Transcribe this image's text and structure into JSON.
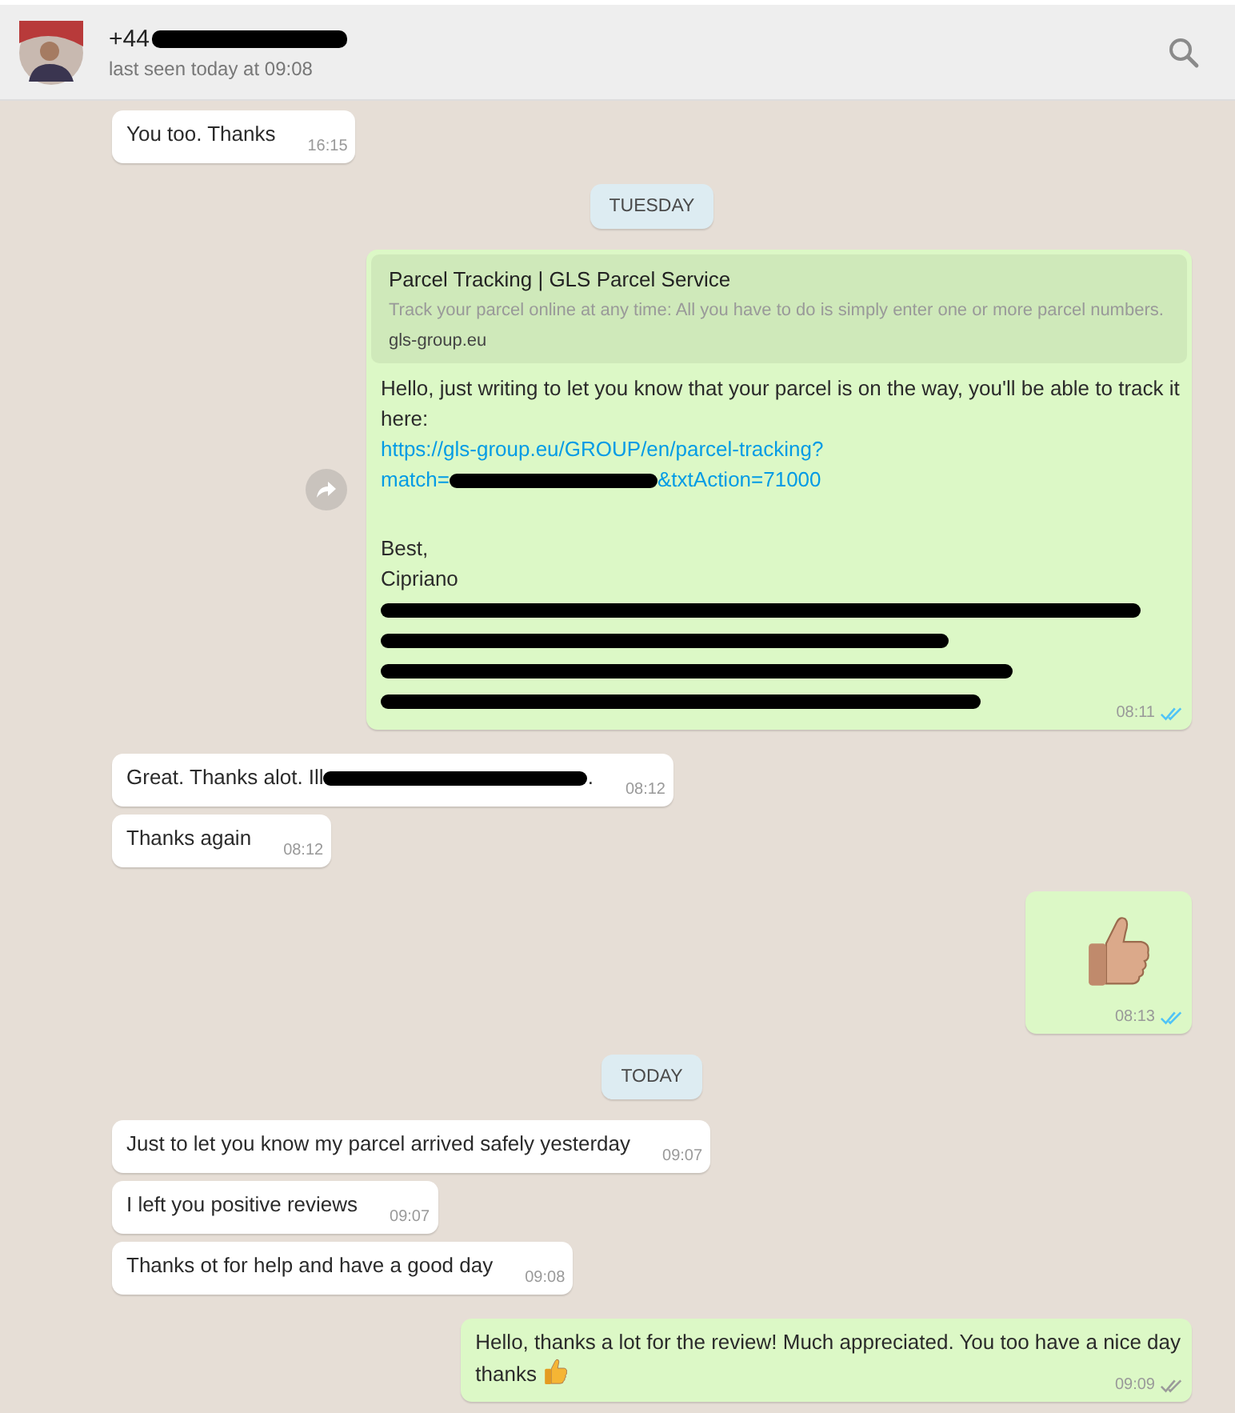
{
  "header": {
    "name": "+44",
    "subtitle": "last seen today at 09:08"
  },
  "messages": [
    {
      "kind": "in",
      "blocks": [
        [
          {
            "kind": "text",
            "text": "You too. Thanks"
          }
        ]
      ],
      "time": "16:15"
    },
    {
      "kind": "date",
      "label": "TUESDAY"
    },
    {
      "kind": "out",
      "forward": true,
      "read": true,
      "time": "08:11",
      "preview": {
        "title": "Parcel Tracking | GLS Parcel Service",
        "description": "Track your parcel online at any time: All you have to do is simply enter one or more parcel numbers.",
        "domain": "gls-group.eu"
      },
      "blocks": [
        [
          {
            "kind": "text",
            "text": "Hello, just writing to let you know that your parcel is on the way, you'll be able to track it here:"
          }
        ],
        [
          {
            "kind": "link",
            "text": "https://gls-group.eu/GROUP/en/parcel-tracking?"
          }
        ],
        [
          {
            "kind": "link",
            "text": "match="
          },
          {
            "kind": "redacted"
          },
          {
            "kind": "link",
            "text": "&txtAction=71000"
          }
        ],
        [
          {
            "kind": "blank"
          }
        ],
        [
          {
            "kind": "text",
            "text": "Best,"
          }
        ],
        [
          {
            "kind": "text",
            "text": "Cipriano"
          }
        ],
        [
          {
            "kind": "redacted"
          }
        ],
        [
          {
            "kind": "redacted"
          }
        ],
        [
          {
            "kind": "redacted"
          }
        ],
        [
          {
            "kind": "redacted"
          }
        ]
      ]
    },
    {
      "kind": "in",
      "blocks": [
        [
          {
            "kind": "text",
            "text": "Great. Thanks alot. Ill"
          },
          {
            "kind": "redacted"
          },
          {
            "kind": "text",
            "text": "."
          }
        ]
      ],
      "time": "08:12"
    },
    {
      "kind": "in",
      "blocks": [
        [
          {
            "kind": "text",
            "text": "Thanks again"
          }
        ]
      ],
      "time": "08:12"
    },
    {
      "kind": "out",
      "read": true,
      "time": "08:13",
      "blocks": [
        [
          {
            "kind": "big-emoji"
          }
        ]
      ]
    },
    {
      "kind": "date",
      "label": "TODAY"
    },
    {
      "kind": "in",
      "blocks": [
        [
          {
            "kind": "text",
            "text": "Just to let you know my parcel arrived safely yesterday"
          }
        ]
      ],
      "time": "09:07"
    },
    {
      "kind": "in",
      "blocks": [
        [
          {
            "kind": "text",
            "text": "I left you positive reviews"
          }
        ]
      ],
      "time": "09:07"
    },
    {
      "kind": "in",
      "blocks": [
        [
          {
            "kind": "text",
            "text": "Thanks ot for help and have a good day"
          }
        ]
      ],
      "time": "09:08"
    },
    {
      "kind": "out",
      "read": false,
      "time": "09:09",
      "blocks": [
        [
          {
            "kind": "text",
            "text": "Hello, thanks a lot for the review! Much appreciated. You too have a nice day"
          }
        ],
        [
          {
            "kind": "text",
            "text": "thanks"
          },
          {
            "kind": "emoji"
          }
        ]
      ]
    }
  ]
}
